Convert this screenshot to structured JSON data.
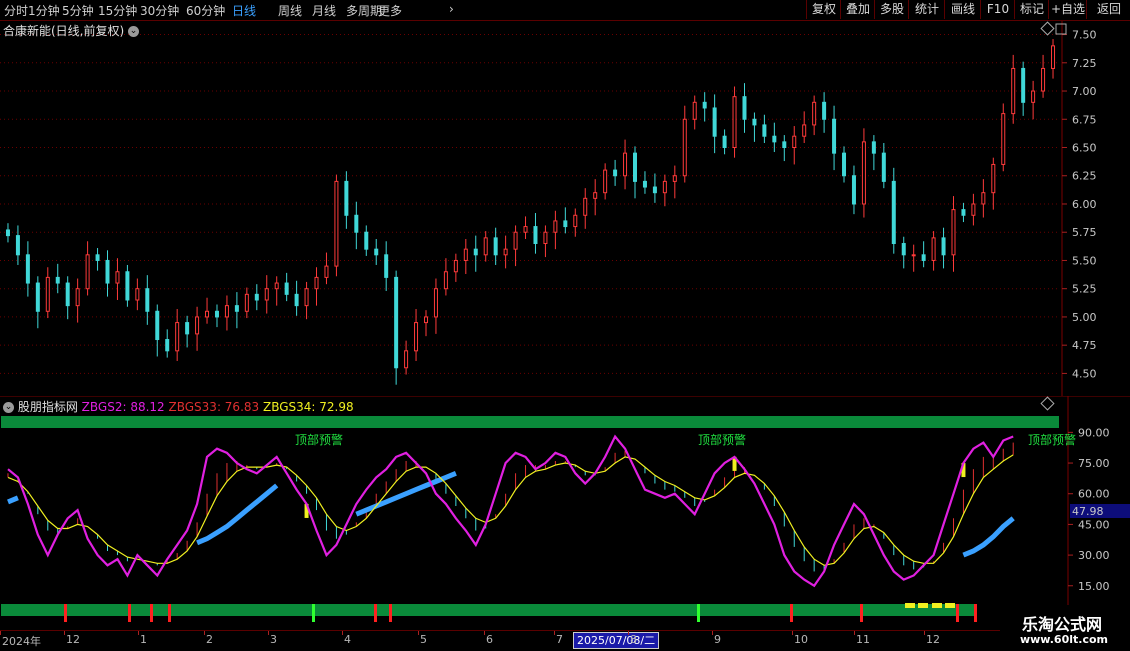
{
  "toolbar": {
    "periods": [
      "分时",
      "1分钟",
      "5分钟",
      "15分钟",
      "30分钟",
      "60分钟",
      "日线",
      "周线",
      "月线",
      "多周期",
      "更多"
    ],
    "active_period": "日线",
    "more_chevron": "›",
    "right_buttons": [
      "复权",
      "叠加",
      "多股",
      "统计",
      "画线",
      "F10",
      "标记",
      "+自选",
      "返回"
    ]
  },
  "main_chart": {
    "title": "合康新能(日线,前复权)",
    "y_ticks": [
      "7.50",
      "7.25",
      "7.00",
      "6.75",
      "6.50",
      "6.25",
      "6.00",
      "5.75",
      "5.50",
      "5.25",
      "5.00",
      "4.75",
      "4.50"
    ],
    "y_min": 4.3,
    "y_max": 7.62
  },
  "indicator": {
    "name": "股朋指标网",
    "z2_label": "ZBGS2: 88.12",
    "z33_label": "ZBGS33: 76.83",
    "z34_label": "ZBGS34: 72.98",
    "y_ticks": [
      "90.00",
      "75.00",
      "60.00",
      "45.00",
      "30.00",
      "15.00"
    ],
    "current_value": "47.98",
    "warning_text": "顶部预警",
    "colors": {
      "z2": "#e020e0",
      "z33": "#e03030",
      "z34": "#f0f020",
      "accent_blue": "#3aa0ff",
      "green_band": "#0a8a3a"
    }
  },
  "date_axis": {
    "labels": [
      "2024年",
      "12",
      "1",
      "2",
      "3",
      "4",
      "5",
      "6",
      "7",
      "8",
      "9",
      "10",
      "11",
      "12"
    ],
    "cursor_date": "2025/07/08/二"
  },
  "watermark": {
    "line1": "乐淘公式网",
    "line2": "www.60lt.com"
  },
  "chart_data": {
    "type": "line",
    "series": [
      {
        "name": "close",
        "values": [
          5.72,
          5.55,
          5.3,
          5.05,
          5.35,
          5.3,
          5.1,
          5.25,
          5.55,
          5.5,
          5.3,
          5.4,
          5.15,
          5.25,
          5.05,
          4.8,
          4.7,
          4.95,
          4.85,
          5.0,
          5.05,
          5.0,
          5.1,
          5.05,
          5.2,
          5.15,
          5.25,
          5.3,
          5.2,
          5.1,
          5.25,
          5.35,
          5.45,
          6.2,
          5.9,
          5.75,
          5.6,
          5.55,
          5.35,
          4.55,
          4.7,
          4.95,
          5.0,
          5.25,
          5.4,
          5.5,
          5.6,
          5.55,
          5.7,
          5.55,
          5.6,
          5.75,
          5.8,
          5.65,
          5.75,
          5.85,
          5.8,
          5.9,
          6.05,
          6.1,
          6.3,
          6.25,
          6.45,
          6.2,
          6.15,
          6.1,
          6.2,
          6.25,
          6.75,
          6.9,
          6.85,
          6.6,
          6.5,
          6.95,
          6.75,
          6.7,
          6.6,
          6.55,
          6.5,
          6.6,
          6.7,
          6.9,
          6.75,
          6.45,
          6.25,
          6.0,
          6.55,
          6.45,
          6.2,
          5.65,
          5.55,
          5.55,
          5.5,
          5.7,
          5.55,
          5.95,
          5.9,
          6.0,
          6.1,
          6.35,
          6.8,
          7.2,
          6.9,
          7.0,
          7.2,
          7.4
        ]
      },
      {
        "name": "ZBGS2",
        "values": [
          72,
          68,
          55,
          40,
          30,
          40,
          48,
          52,
          38,
          30,
          25,
          28,
          20,
          30,
          25,
          20,
          28,
          35,
          42,
          55,
          78,
          82,
          80,
          75,
          72,
          70,
          74,
          78,
          70,
          62,
          55,
          42,
          30,
          35,
          45,
          55,
          62,
          68,
          72,
          78,
          80,
          75,
          70,
          60,
          55,
          48,
          42,
          35,
          45,
          60,
          75,
          80,
          78,
          72,
          75,
          80,
          78,
          70,
          65,
          70,
          78,
          88,
          82,
          72,
          62,
          60,
          58,
          60,
          55,
          50,
          60,
          70,
          75,
          78,
          72,
          65,
          55,
          45,
          30,
          22,
          18,
          15,
          22,
          35,
          45,
          55,
          50,
          40,
          30,
          22,
          18,
          20,
          25,
          30,
          45,
          60,
          75,
          82,
          85,
          78,
          86,
          88
        ]
      },
      {
        "name": "ZBGS33",
        "values": [
          70,
          67,
          60,
          50,
          42,
          40,
          44,
          48,
          44,
          38,
          32,
          30,
          27,
          28,
          27,
          25,
          27,
          31,
          37,
          46,
          60,
          70,
          75,
          76,
          74,
          72,
          73,
          75,
          72,
          66,
          60,
          52,
          42,
          38,
          40,
          46,
          53,
          60,
          66,
          72,
          76,
          76,
          73,
          66,
          60,
          54,
          48,
          42,
          43,
          50,
          60,
          70,
          74,
          74,
          74,
          76,
          76,
          73,
          69,
          69,
          73,
          80,
          81,
          77,
          70,
          65,
          62,
          61,
          58,
          54,
          56,
          62,
          68,
          73,
          73,
          69,
          62,
          54,
          44,
          34,
          27,
          22,
          22,
          28,
          36,
          45,
          48,
          45,
          38,
          30,
          25,
          23,
          24,
          27,
          36,
          48,
          62,
          72,
          78,
          78,
          82,
          85
        ]
      },
      {
        "name": "ZBGS34",
        "values": [
          68,
          66,
          61,
          54,
          47,
          43,
          43,
          45,
          44,
          40,
          35,
          32,
          29,
          28,
          27,
          26,
          26,
          28,
          32,
          39,
          49,
          59,
          66,
          71,
          73,
          73,
          73,
          74,
          73,
          69,
          64,
          58,
          50,
          44,
          42,
          44,
          48,
          54,
          60,
          66,
          71,
          73,
          73,
          70,
          65,
          59,
          53,
          48,
          46,
          48,
          54,
          62,
          68,
          71,
          72,
          74,
          75,
          74,
          71,
          70,
          71,
          75,
          78,
          77,
          73,
          69,
          66,
          64,
          61,
          58,
          57,
          59,
          63,
          68,
          70,
          69,
          65,
          59,
          51,
          42,
          34,
          28,
          25,
          26,
          31,
          38,
          43,
          44,
          41,
          35,
          30,
          27,
          26,
          26,
          31,
          39,
          50,
          60,
          68,
          72,
          76,
          79
        ]
      },
      {
        "name": "blue_line",
        "values": [
          56,
          58,
          null,
          null,
          null,
          null,
          null,
          null,
          null,
          null,
          null,
          null,
          null,
          null,
          null,
          null,
          null,
          null,
          null,
          36,
          38,
          41,
          44,
          48,
          52,
          56,
          60,
          64,
          null,
          null,
          null,
          null,
          null,
          null,
          null,
          50,
          52,
          54,
          56,
          58,
          60,
          62,
          64,
          66,
          68,
          70,
          null,
          null,
          null,
          null,
          null,
          null,
          null,
          null,
          null,
          null,
          null,
          null,
          null,
          null,
          null,
          null,
          null,
          null,
          null,
          null,
          null,
          null,
          null,
          null,
          null,
          null,
          null,
          null,
          null,
          null,
          null,
          null,
          null,
          null,
          null,
          null,
          null,
          null,
          null,
          null,
          null,
          null,
          null,
          null,
          null,
          null,
          null,
          null,
          null,
          null,
          30,
          32,
          35,
          39,
          44,
          48
        ]
      }
    ],
    "ylim_price": [
      4.3,
      7.62
    ],
    "ylim_indicator": [
      10,
      98
    ]
  }
}
